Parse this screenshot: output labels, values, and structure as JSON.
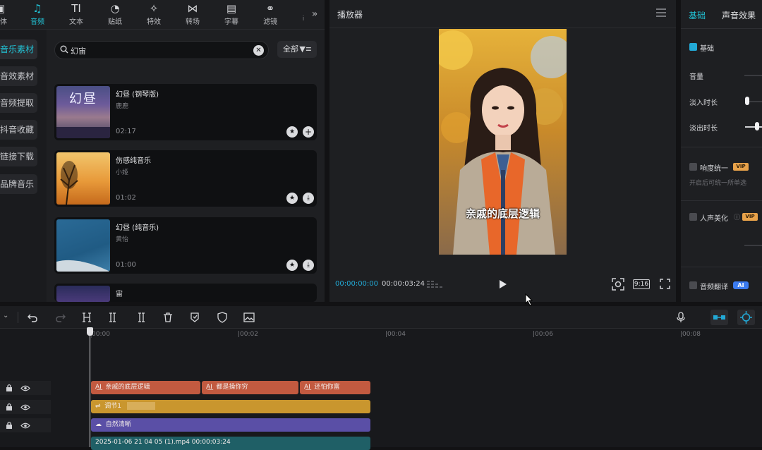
{
  "top_tabs": [
    {
      "label": "媒体",
      "icon": "media-icon"
    },
    {
      "label": "音频",
      "icon": "audio-icon",
      "active": true
    },
    {
      "label": "文本",
      "icon": "text-icon"
    },
    {
      "label": "贴纸",
      "icon": "sticker-icon"
    },
    {
      "label": "特效",
      "icon": "effects-icon"
    },
    {
      "label": "转场",
      "icon": "transition-icon"
    },
    {
      "label": "字幕",
      "icon": "caption-icon"
    },
    {
      "label": "滤镜",
      "icon": "filter-icon"
    }
  ],
  "categories": [
    {
      "label": "音乐素材",
      "active": true
    },
    {
      "label": "音效素材"
    },
    {
      "label": "音频提取"
    },
    {
      "label": "抖音收藏"
    },
    {
      "label": "链接下载"
    },
    {
      "label": "品牌音乐"
    }
  ],
  "search": {
    "value": "幻宙"
  },
  "filter": {
    "label": "全部"
  },
  "tracks": [
    {
      "title": "幻昼 (钢琴版)",
      "artist": "鹿鹿",
      "duration": "02:17",
      "thumb_text": "幻昼"
    },
    {
      "title": "伤感纯音乐",
      "artist": "小姬",
      "duration": "01:02"
    },
    {
      "title": "幻昼 (纯音乐)",
      "artist": "黄怡",
      "duration": "01:00"
    },
    {
      "title": "宙",
      "artist": "",
      "duration": ""
    }
  ],
  "player": {
    "title": "播放器",
    "subtitle": "亲戚的底层逻辑",
    "time_current": "00:00:00:00",
    "time_total": "00:00:03:24",
    "ratio": "9:16"
  },
  "right_panel": {
    "tabs": [
      "基础",
      "声音效果"
    ],
    "section_basic": "基础",
    "volume": "音量",
    "fade_in": "淡入时长",
    "fade_out": "淡出时长",
    "loudness": "响度统一",
    "loudness_desc": "开启后可统一所单选",
    "voice_beautify": "人声美化",
    "audio_translate": "音频翻译",
    "vip": "VIP",
    "ai": "AI"
  },
  "timeline": {
    "ruler": [
      "00:00",
      "|00:02",
      "|00:04",
      "|00:06",
      "|00:08"
    ],
    "text_clips": [
      "亲戚的底层逻辑",
      "都是操你穷",
      "还怕你富"
    ],
    "adjust_clip": "调节1",
    "filter_clip": "自然清晰",
    "video_clip": "2025-01-06 21 04 05 (1).mp4   00:00:03:24",
    "colors": {
      "text": "#c25a40",
      "adjust": "#c9962e",
      "filter": "#5a4fa6",
      "video": "#1f5f66"
    }
  }
}
